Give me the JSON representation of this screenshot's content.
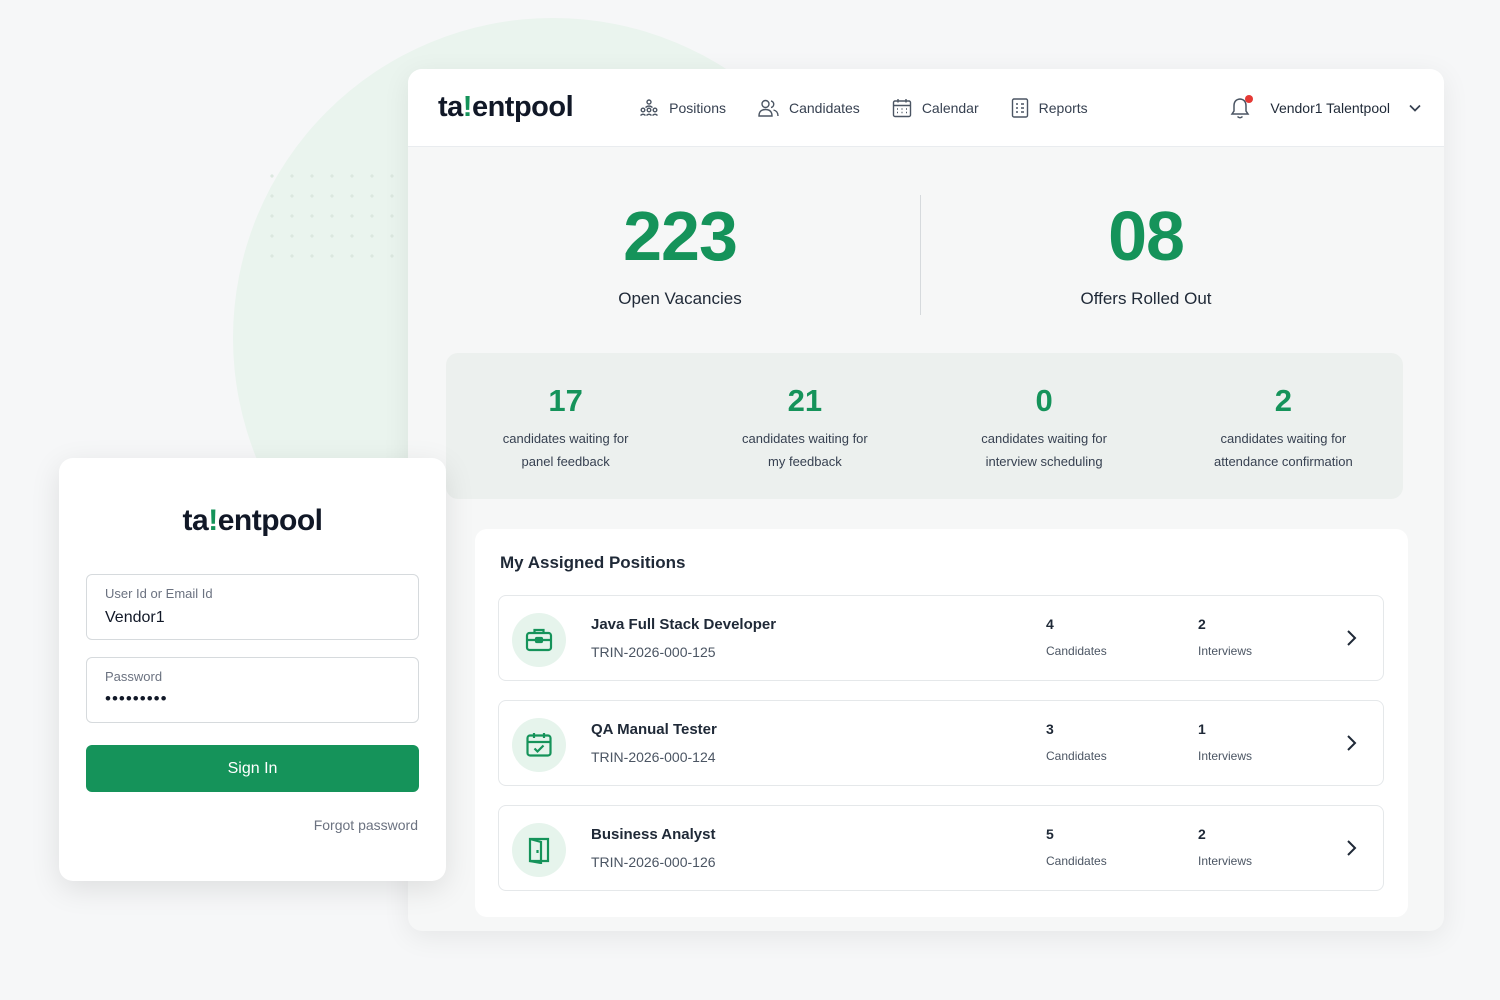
{
  "brand": {
    "logo_prefix": "ta",
    "logo_mark": "!",
    "logo_suffix": "entpool",
    "accent": "#15935a"
  },
  "nav": {
    "items": [
      {
        "label": "Positions",
        "icon": "org-chart-icon"
      },
      {
        "label": "Candidates",
        "icon": "users-icon"
      },
      {
        "label": "Calendar",
        "icon": "calendar-icon"
      },
      {
        "label": "Reports",
        "icon": "report-icon"
      }
    ],
    "user_name": "Vendor1 Talentpool",
    "notifications_icon": "bell-icon"
  },
  "stats": {
    "open_vacancies": {
      "value": "223",
      "label": "Open Vacancies"
    },
    "offers_rolled_out": {
      "value": "08",
      "label": "Offers Rolled Out"
    }
  },
  "waiting": [
    {
      "value": "17",
      "line1": "candidates waiting for",
      "line2": "panel feedback"
    },
    {
      "value": "21",
      "line1": "candidates waiting for",
      "line2": "my feedback"
    },
    {
      "value": "0",
      "line1": "candidates waiting for",
      "line2": "interview scheduling"
    },
    {
      "value": "2",
      "line1": "candidates waiting for",
      "line2": "attendance confirmation"
    }
  ],
  "assigned": {
    "title": "My Assigned Positions",
    "positions": [
      {
        "title": "Java Full Stack Developer",
        "code": "TRIN-2026-000-125",
        "candidates": "4",
        "candidates_label": "Candidates",
        "interviews": "2",
        "interviews_label": "Interviews",
        "icon": "briefcase-icon"
      },
      {
        "title": "QA Manual Tester",
        "code": "TRIN-2026-000-124",
        "candidates": "3",
        "candidates_label": "Candidates",
        "interviews": "1",
        "interviews_label": "Interviews",
        "icon": "calendar-check-icon"
      },
      {
        "title": "Business Analyst",
        "code": "TRIN-2026-000-126",
        "candidates": "5",
        "candidates_label": "Candidates",
        "interviews": "2",
        "interviews_label": "Interviews",
        "icon": "door-icon"
      }
    ]
  },
  "login": {
    "user_label": "User Id or Email Id",
    "user_value": "Vendor1",
    "password_label": "Password",
    "password_value": "•••••••••",
    "signin_label": "Sign In",
    "forgot_label": "Forgot password"
  }
}
